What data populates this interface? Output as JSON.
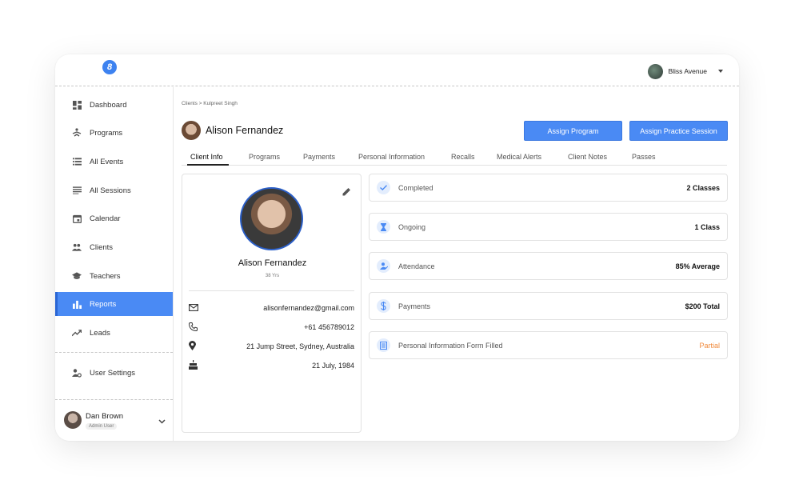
{
  "topbar": {
    "logo_text": "8",
    "account_name": "Bliss Avenue"
  },
  "sidebar": {
    "items": [
      {
        "label": "Dashboard"
      },
      {
        "label": "Programs"
      },
      {
        "label": "All Events"
      },
      {
        "label": "All Sessions"
      },
      {
        "label": "Calendar"
      },
      {
        "label": "Clients"
      },
      {
        "label": "Teachers"
      },
      {
        "label": "Reports"
      },
      {
        "label": "Leads"
      },
      {
        "label": "User Settings"
      }
    ],
    "active": "Reports"
  },
  "user": {
    "name": "Dan Brown",
    "role": "Admin User"
  },
  "breadcrumb": "Clients > Kulpreet Singh",
  "client_header": {
    "name": "Alison Fernandez"
  },
  "buttons": {
    "assign_program": "Assign Program",
    "assign_practice": "Assign Practice Session"
  },
  "tabs": [
    {
      "label": "Client Info"
    },
    {
      "label": "Programs"
    },
    {
      "label": "Payments"
    },
    {
      "label": "Personal Information"
    },
    {
      "label": "Recalls"
    },
    {
      "label": "Medical Alerts"
    },
    {
      "label": "Client Notes"
    },
    {
      "label": "Passes"
    }
  ],
  "profile": {
    "name": "Alison Fernandez",
    "age": "38 Yrs",
    "email": "alisonfernandez@gmail.com",
    "phone": "+61 456789012",
    "address": "21 Jump Street, Sydney, Australia",
    "birthday": "21 July, 1984"
  },
  "stats": [
    {
      "label": "Completed",
      "value": "2 Classes",
      "icon": "check-icon"
    },
    {
      "label": "Ongoing",
      "value": "1 Class",
      "icon": "hourglass-icon"
    },
    {
      "label": "Attendance",
      "value": "85% Average",
      "icon": "person-check-icon"
    },
    {
      "label": "Payments",
      "value": "$200 Total",
      "icon": "dollar-icon"
    },
    {
      "label": "Personal Information Form Filled",
      "value": "Partial",
      "icon": "form-icon"
    }
  ],
  "colors": {
    "accent": "#4a8af4",
    "partial": "#f08a3c",
    "icon_bg": "#e3edfd"
  }
}
